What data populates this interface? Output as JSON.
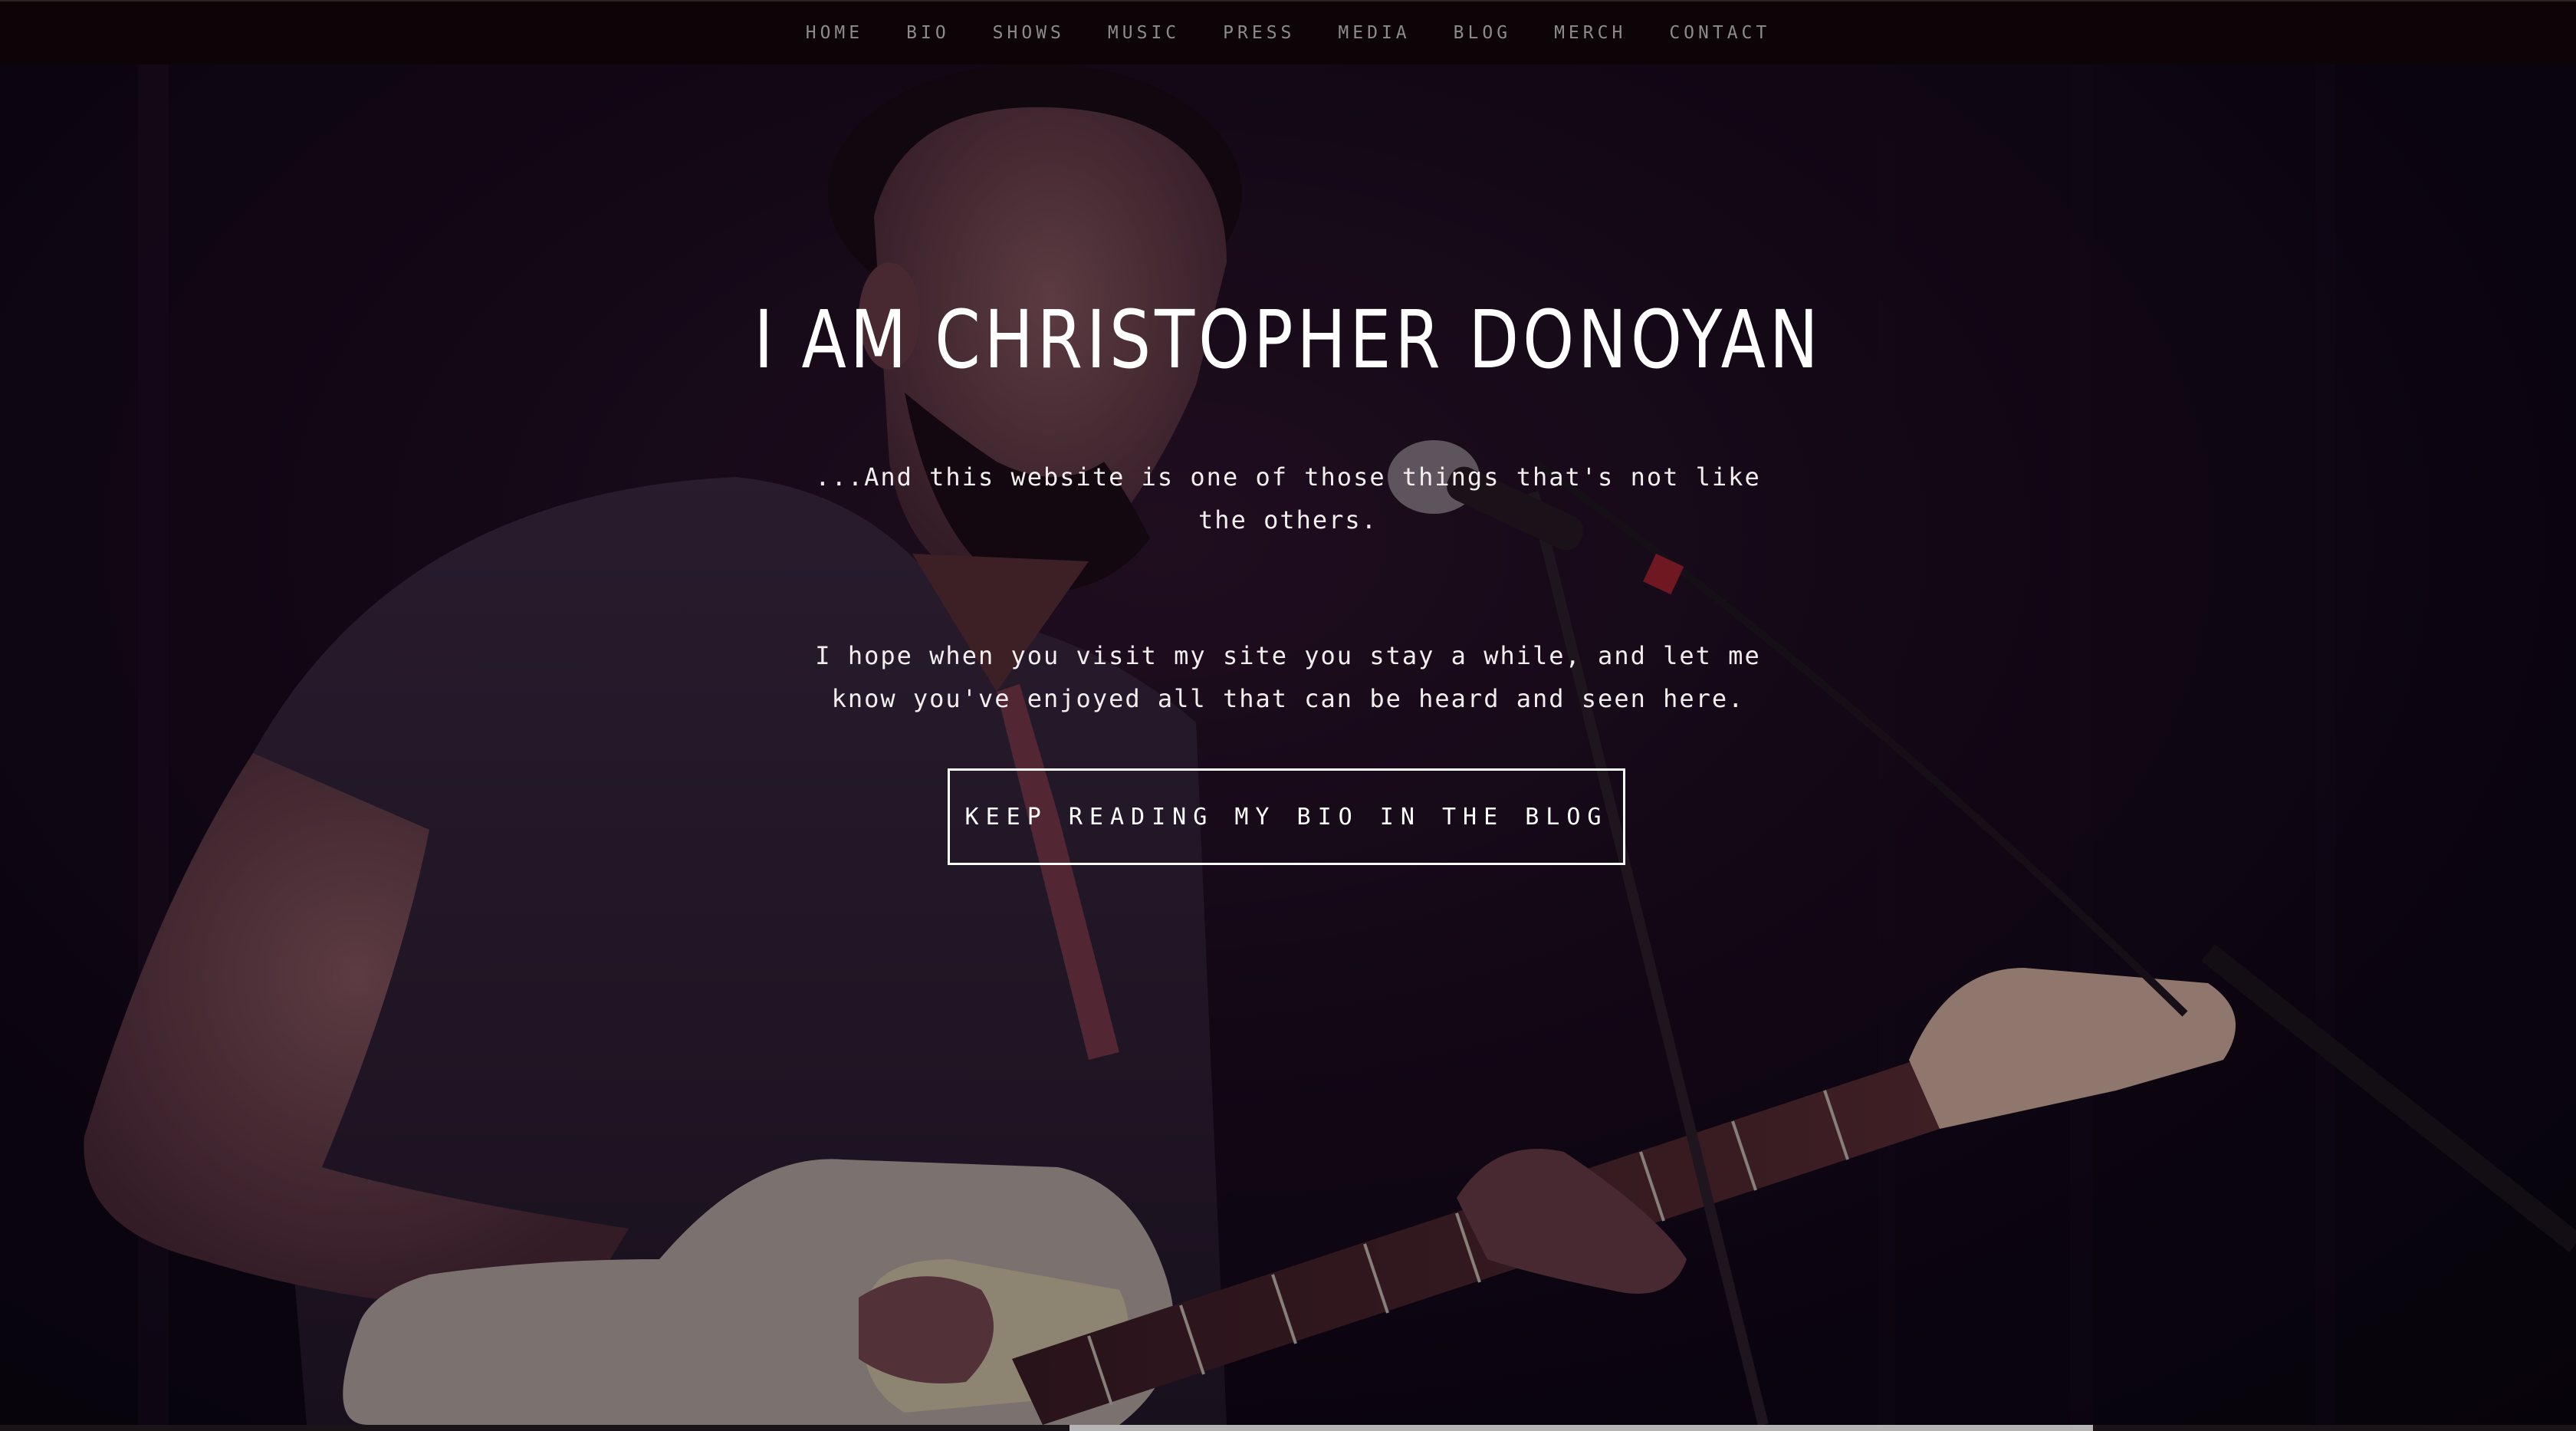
{
  "nav": {
    "items": [
      {
        "label": "HOME"
      },
      {
        "label": "BIO"
      },
      {
        "label": "SHOWS"
      },
      {
        "label": "MUSIC"
      },
      {
        "label": "PRESS"
      },
      {
        "label": "MEDIA"
      },
      {
        "label": "BLOG"
      },
      {
        "label": "MERCH"
      },
      {
        "label": "CONTACT"
      }
    ]
  },
  "hero": {
    "title": "I AM CHRISTOPHER DONOYAN",
    "paragraph_1": "...And this website is one of those things that's not like the others.",
    "paragraph_2": "I hope when you visit my site you stay a while, and let me know you've enjoyed all that can be heard and seen here.",
    "cta_label": "KEEP READING MY BIO IN THE BLOG",
    "background_image": "guitarist-singing-photo"
  },
  "colors": {
    "nav_bg": "#0c0406",
    "nav_text": "#8c8a8c",
    "hero_text": "#ffffff",
    "hero_bg": "#0b0710"
  }
}
